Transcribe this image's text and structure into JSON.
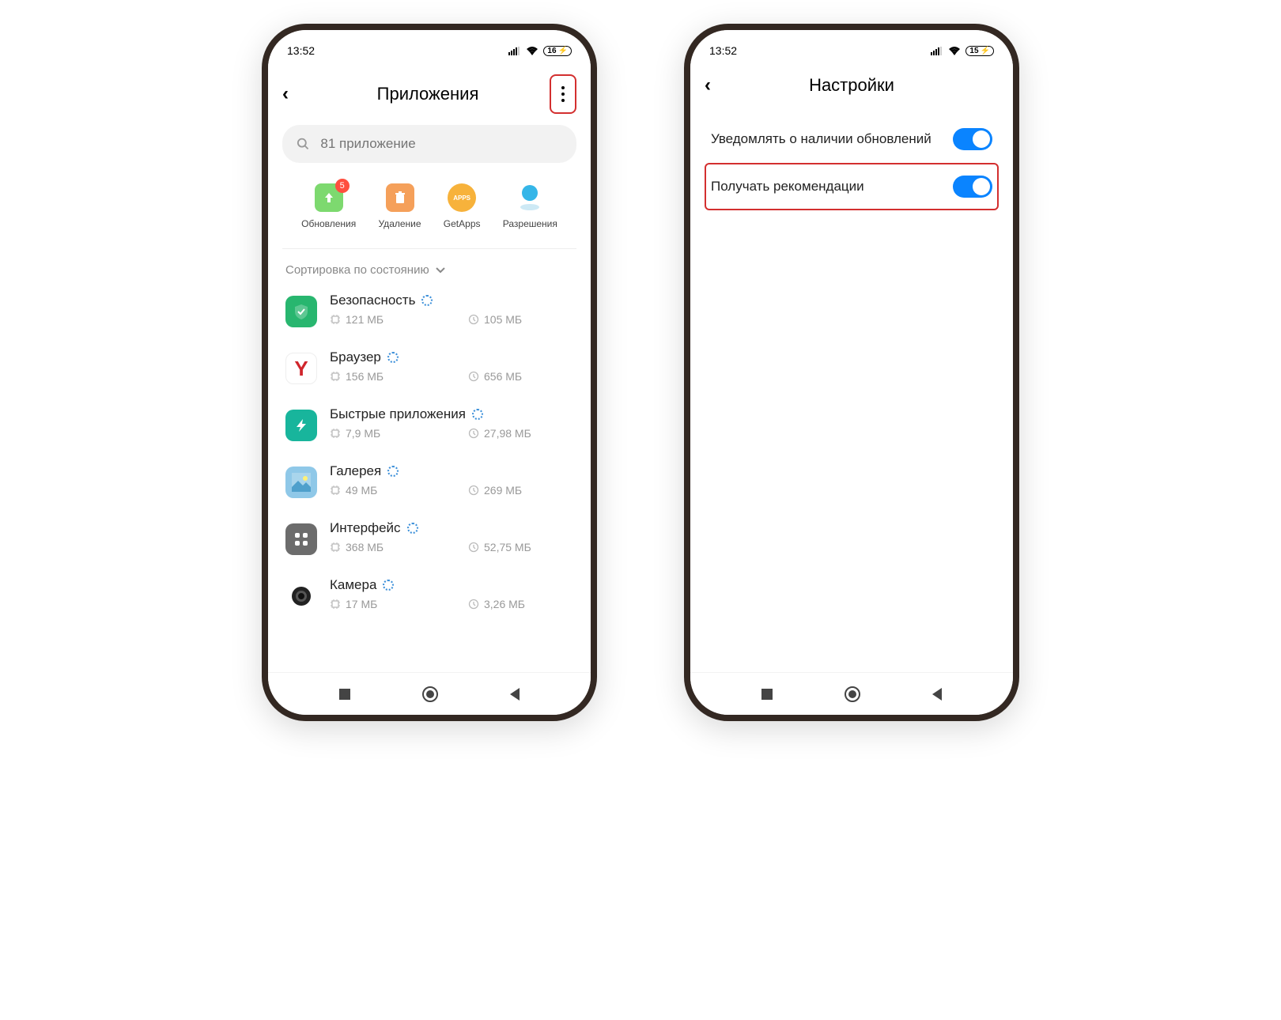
{
  "status": {
    "time": "13:52",
    "battery_left": "16",
    "battery_right": "15"
  },
  "left": {
    "title": "Приложения",
    "search_placeholder": "81 приложение",
    "quick": {
      "updates": {
        "label": "Обновления",
        "badge": "5"
      },
      "uninstall": {
        "label": "Удаление"
      },
      "getapps": {
        "label": "GetApps",
        "tag": "APPS"
      },
      "permissions": {
        "label": "Разрешения"
      }
    },
    "sort_label": "Сортировка по состоянию",
    "apps": [
      {
        "name": "Безопасность",
        "storage": "121 МБ",
        "runtime": "105 МБ",
        "color": "#28b66f",
        "glyph": "shield"
      },
      {
        "name": "Браузер",
        "storage": "156 МБ",
        "runtime": "656 МБ",
        "color": "#ffffff",
        "glyph": "y"
      },
      {
        "name": "Быстрые приложения",
        "storage": "7,9 МБ",
        "runtime": "27,98 МБ",
        "color": "#18b59c",
        "glyph": "bolt"
      },
      {
        "name": "Галерея",
        "storage": "49 МБ",
        "runtime": "269 МБ",
        "color": "#8fc8e8",
        "glyph": "gallery"
      },
      {
        "name": "Интерфейс",
        "storage": "368 МБ",
        "runtime": "52,75 МБ",
        "color": "#6c6c6c",
        "glyph": "grid"
      },
      {
        "name": "Камера",
        "storage": "17 МБ",
        "runtime": "3,26 МБ",
        "color": "#222222",
        "glyph": "dot"
      }
    ]
  },
  "right": {
    "title": "Настройки",
    "settings": [
      {
        "label": "Уведомлять о наличии обновлений",
        "on": true
      },
      {
        "label": "Получать рекомендации",
        "on": true
      }
    ]
  }
}
